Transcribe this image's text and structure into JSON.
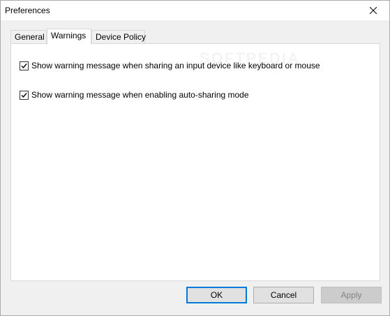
{
  "window": {
    "title": "Preferences"
  },
  "tabs": [
    {
      "label": "General",
      "active": false
    },
    {
      "label": "Warnings",
      "active": true
    },
    {
      "label": "Device Policy",
      "active": false
    }
  ],
  "warnings": {
    "watermark": "SOFTPEDIA",
    "options": [
      {
        "label": "Show warning message when sharing an input device like keyboard or mouse",
        "checked": true
      },
      {
        "label": "Show warning message when enabling auto-sharing mode",
        "checked": true
      }
    ]
  },
  "buttons": {
    "ok": "OK",
    "cancel": "Cancel",
    "apply": "Apply"
  },
  "icons": {
    "close": "close-icon",
    "check": "checkmark-icon"
  },
  "colors": {
    "focus_border": "#0078d7",
    "disabled_text": "#838383"
  }
}
